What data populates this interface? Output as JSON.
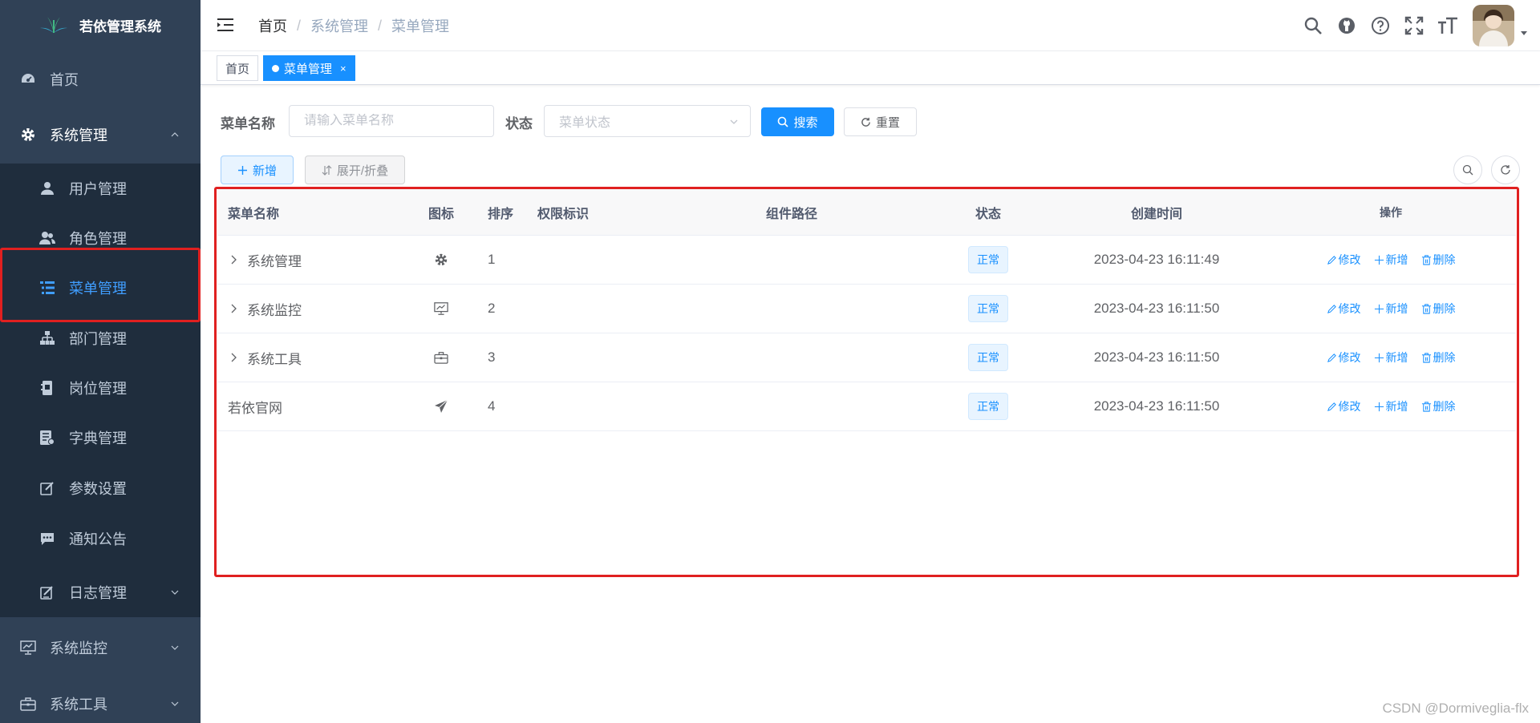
{
  "app": {
    "title": "若依管理系统"
  },
  "sidebar": {
    "home": "首页",
    "system": "系统管理",
    "sub_items": [
      {
        "label": "用户管理",
        "icon": "user-icon"
      },
      {
        "label": "角色管理",
        "icon": "peoples-icon"
      },
      {
        "label": "菜单管理",
        "icon": "tree-table-icon",
        "active": true
      },
      {
        "label": "部门管理",
        "icon": "tree-icon"
      },
      {
        "label": "岗位管理",
        "icon": "post-icon"
      },
      {
        "label": "字典管理",
        "icon": "dict-icon"
      },
      {
        "label": "参数设置",
        "icon": "edit-icon"
      },
      {
        "label": "通知公告",
        "icon": "message-icon"
      },
      {
        "label": "日志管理",
        "icon": "log-icon"
      }
    ],
    "monitor": "系统监控",
    "tool": "系统工具"
  },
  "navbar": {
    "breadcrumb": [
      "首页",
      "系统管理",
      "菜单管理"
    ],
    "breadcrumb_sep": "/"
  },
  "tags": {
    "home": "首页",
    "active": "菜单管理",
    "close": "×"
  },
  "search": {
    "name_label": "菜单名称",
    "name_placeholder": "请输入菜单名称",
    "status_label": "状态",
    "status_placeholder": "菜单状态",
    "search_btn": "搜索",
    "reset_btn": "重置"
  },
  "toolbar": {
    "add_btn": "新增",
    "expand_btn": "展开/折叠"
  },
  "table": {
    "headers": {
      "name": "菜单名称",
      "icon": "图标",
      "sort": "排序",
      "perms": "权限标识",
      "component": "组件路径",
      "status": "状态",
      "created": "创建时间",
      "ops": "操作"
    },
    "rows": [
      {
        "name": "系统管理",
        "icon": "system-icon",
        "sort": "1",
        "status": "正常",
        "created": "2023-04-23 16:11:49",
        "expandable": true
      },
      {
        "name": "系统监控",
        "icon": "monitor-icon",
        "sort": "2",
        "status": "正常",
        "created": "2023-04-23 16:11:50",
        "expandable": true
      },
      {
        "name": "系统工具",
        "icon": "tool-icon",
        "sort": "3",
        "status": "正常",
        "created": "2023-04-23 16:11:50",
        "expandable": true
      },
      {
        "name": "若依官网",
        "icon": "guide-icon",
        "sort": "4",
        "status": "正常",
        "created": "2023-04-23 16:11:50",
        "expandable": false
      }
    ],
    "ops": {
      "edit": "修改",
      "add": "新增",
      "delete": "删除"
    }
  },
  "watermark": "CSDN @Dormiveglia-flx",
  "colors": {
    "sidebar": "#304156",
    "submenu": "#1f2d3d",
    "primary": "#1890ff",
    "highlight": "#e02020"
  }
}
